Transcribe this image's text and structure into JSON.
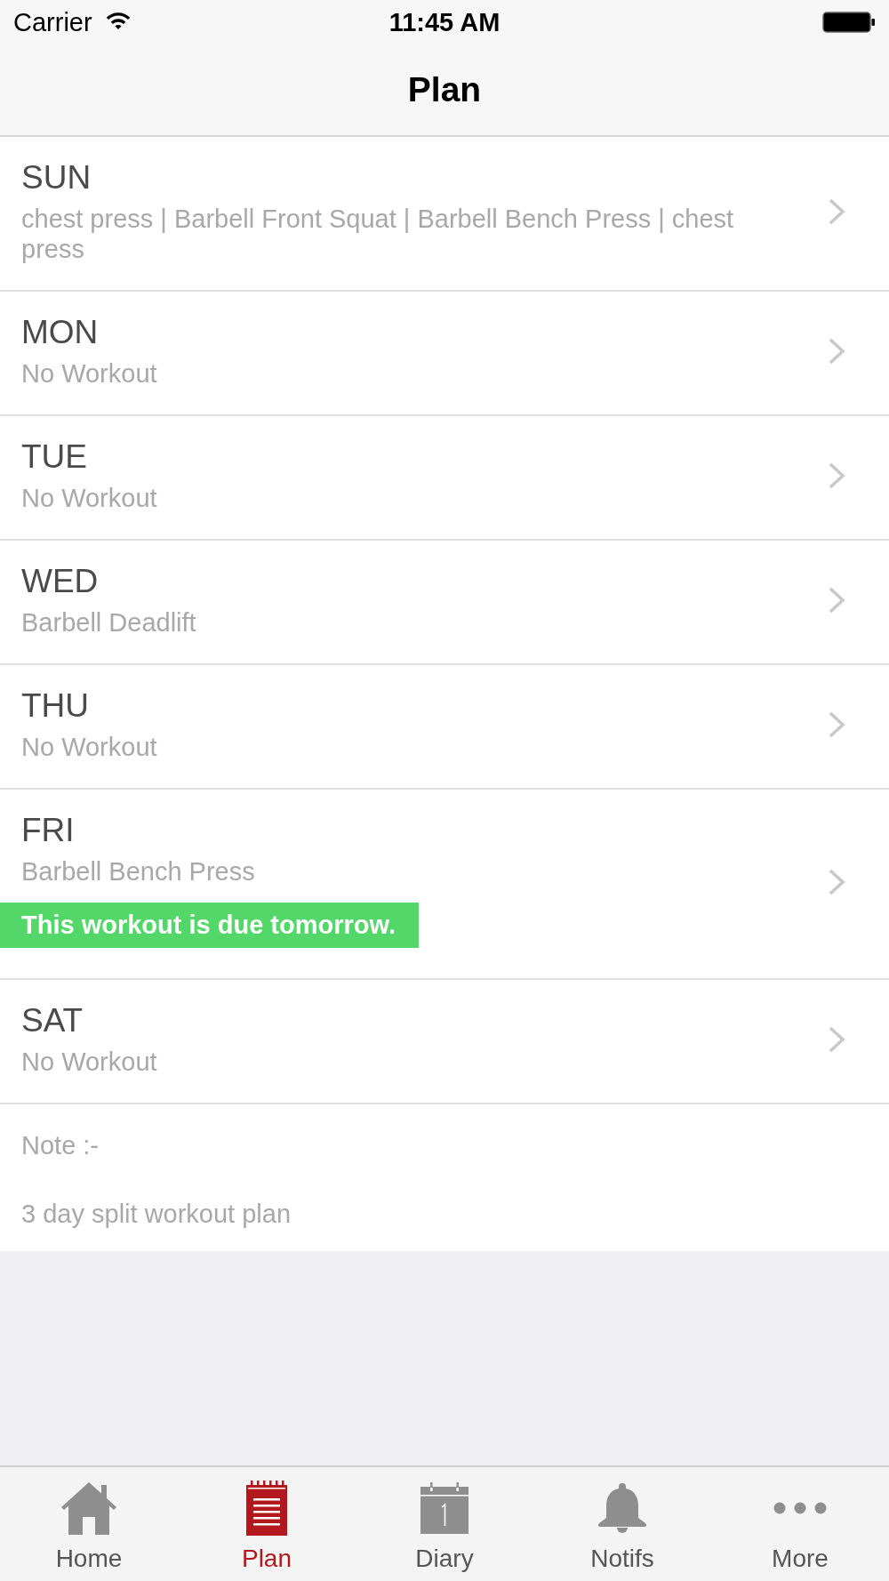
{
  "status_bar": {
    "carrier": "Carrier",
    "time": "11:45 AM"
  },
  "nav_bar": {
    "title": "Plan"
  },
  "days": [
    {
      "day": "SUN",
      "workouts": "chest press | Barbell Front Squat | Barbell Bench Press | chest press"
    },
    {
      "day": "MON",
      "workouts": "No Workout"
    },
    {
      "day": "TUE",
      "workouts": "No Workout"
    },
    {
      "day": "WED",
      "workouts": "Barbell Deadlift"
    },
    {
      "day": "THU",
      "workouts": "No Workout"
    },
    {
      "day": "FRI",
      "workouts": "Barbell Bench Press",
      "banner": "This workout is due tomorrow."
    },
    {
      "day": "SAT",
      "workouts": "No Workout"
    }
  ],
  "note": {
    "label": "Note :-",
    "text": "3 day split workout plan"
  },
  "tab_bar": [
    {
      "kind": "home",
      "label": "Home",
      "selected": false
    },
    {
      "kind": "plan",
      "label": "Plan",
      "selected": true
    },
    {
      "kind": "diary",
      "label": "Diary",
      "selected": false
    },
    {
      "kind": "notifs",
      "label": "Notifs",
      "selected": false
    },
    {
      "kind": "more",
      "label": "More",
      "selected": false
    }
  ]
}
